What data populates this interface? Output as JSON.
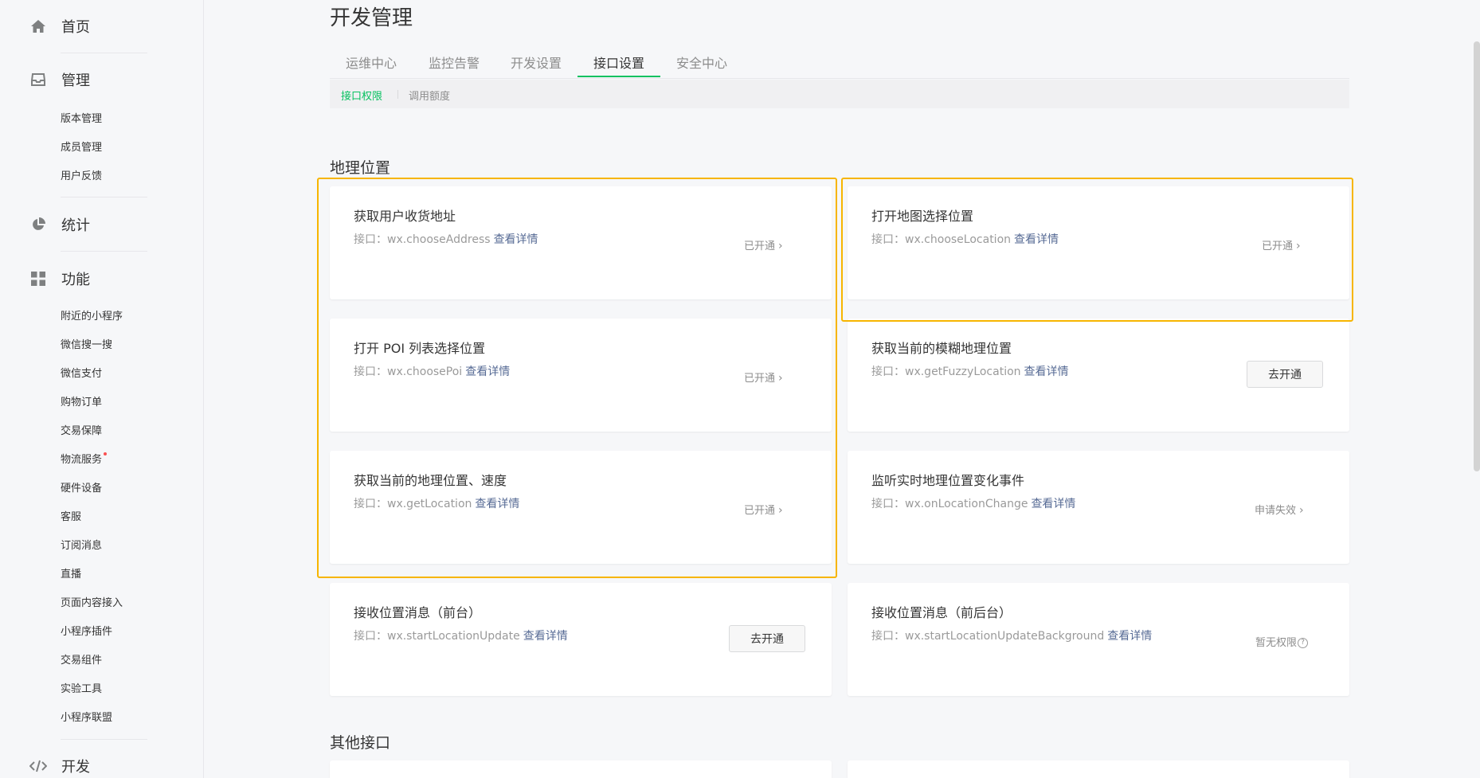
{
  "sidebar": {
    "home": {
      "label": "首页",
      "icon": "home-icon"
    },
    "manage": {
      "label": "管理",
      "icon": "inbox-icon",
      "items": [
        "版本管理",
        "成员管理",
        "用户反馈"
      ]
    },
    "stats": {
      "label": "统计",
      "icon": "pie-chart-icon"
    },
    "features": {
      "label": "功能",
      "icon": "grid-icon",
      "items": [
        "附近的小程序",
        "微信搜一搜",
        "微信支付",
        "购物订单",
        "交易保障",
        "物流服务",
        "硬件设备",
        "客服",
        "订阅消息",
        "直播",
        "页面内容接入",
        "小程序插件",
        "交易组件",
        "实验工具",
        "小程序联盟"
      ]
    },
    "dev": {
      "label": "开发",
      "icon": "code-icon"
    }
  },
  "page": {
    "title": "开发管理",
    "tabs": [
      "运维中心",
      "监控告警",
      "开发设置",
      "接口设置",
      "安全中心"
    ],
    "active_tab": "接口设置",
    "subtabs": [
      "接口权限",
      "调用额度"
    ],
    "active_subtab": "接口权限"
  },
  "sections": {
    "geo": {
      "title": "地理位置",
      "cards": [
        {
          "title": "获取用户收货地址",
          "api_prefix": "接口：",
          "api": "wx.chooseAddress",
          "link": "查看详情",
          "status": "已开通"
        },
        {
          "title": "打开地图选择位置",
          "api_prefix": "接口：",
          "api": "wx.chooseLocation",
          "link": "查看详情",
          "status": "已开通"
        },
        {
          "title": "打开 POI 列表选择位置",
          "api_prefix": "接口：",
          "api": "wx.choosePoi",
          "link": "查看详情",
          "status": "已开通"
        },
        {
          "title": "获取当前的模糊地理位置",
          "api_prefix": "接口：",
          "api": "wx.getFuzzyLocation",
          "link": "查看详情",
          "button": "去开通"
        },
        {
          "title": "获取当前的地理位置、速度",
          "api_prefix": "接口：",
          "api": "wx.getLocation",
          "link": "查看详情",
          "status": "已开通"
        },
        {
          "title": "监听实时地理位置变化事件",
          "api_prefix": "接口：",
          "api": "wx.onLocationChange",
          "link": "查看详情",
          "status": "申请失效"
        },
        {
          "title": "接收位置消息（前台）",
          "api_prefix": "接口：",
          "api": "wx.startLocationUpdate",
          "link": "查看详情",
          "button": "去开通"
        },
        {
          "title": "接收位置消息（前后台）",
          "api_prefix": "接口：",
          "api": "wx.startLocationUpdateBackground",
          "link": "查看详情",
          "status": "暂无权限"
        }
      ]
    },
    "other": {
      "title": "其他接口"
    }
  },
  "colors": {
    "accent": "#07c160",
    "link": "#576b95",
    "highlight": "#f7b500",
    "badge": "#fa5151"
  }
}
